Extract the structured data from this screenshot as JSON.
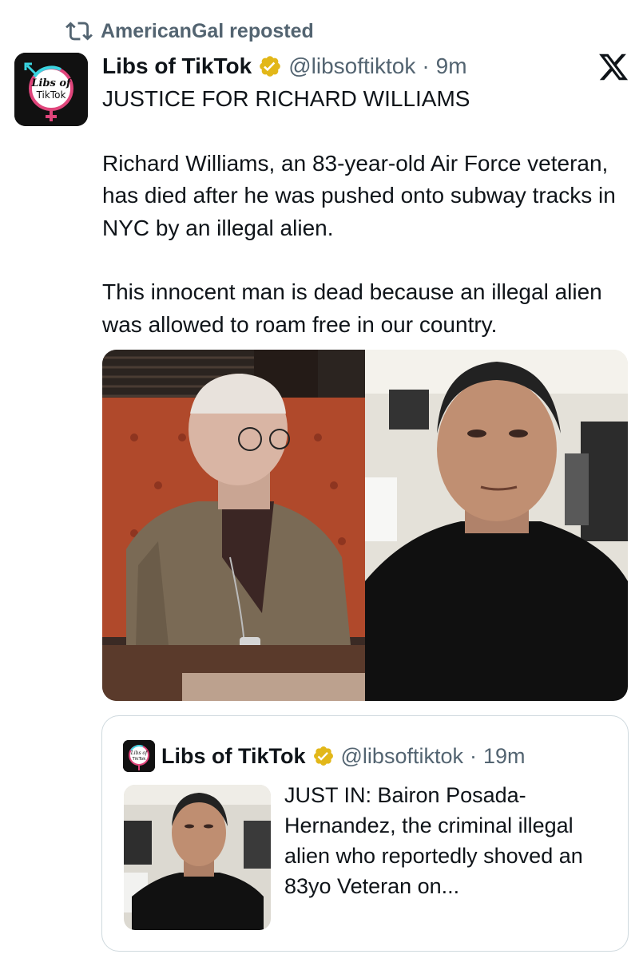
{
  "repost": {
    "text": "AmericanGal reposted",
    "icon": "repost-icon"
  },
  "author": {
    "avatar_text_line1": "Libs of",
    "avatar_text_line2": "TikTok",
    "name": "Libs of TikTok",
    "handle": "@libsoftiktok",
    "separator": "·",
    "time": "9m"
  },
  "tweet": {
    "line1": "JUSTICE FOR RICHARD WILLIAMS",
    "para2": "Richard Williams, an 83-year-old Air Force veteran, has died after he was pushed onto subway tracks in NYC by an illegal alien.",
    "para3": "This innocent man is dead because an illegal alien was allowed to roam free in our country."
  },
  "quote": {
    "avatar_text_line1": "Libs of",
    "avatar_text_line2": "TikTok",
    "name": "Libs of TikTok",
    "handle": "@libsoftiktok",
    "separator": "·",
    "time": "19m",
    "text": "JUST IN: Bairon Posada-Hernandez, the criminal illegal alien who reportedly shoved an 83yo Veteran on..."
  },
  "colors": {
    "text": "#0f1419",
    "secondary": "#536471",
    "verified_gold": "#e2b719",
    "border": "#cfd9de",
    "logo_pink": "#e0457b",
    "logo_cyan": "#3ad4e0"
  }
}
